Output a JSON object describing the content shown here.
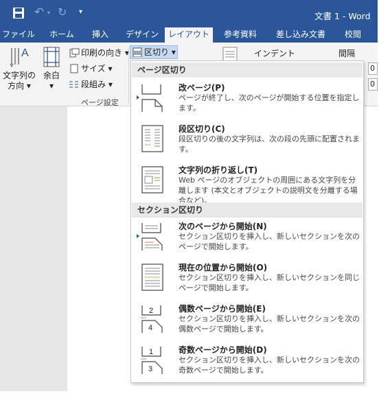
{
  "window": {
    "title": "文書 1 - Word"
  },
  "qat": {
    "undo_symbol": "↶",
    "redo_symbol": "↻",
    "more_symbol": "▾",
    "dropdown_symbol": "▾"
  },
  "tabs": [
    {
      "label": "ファイル"
    },
    {
      "label": "ホーム"
    },
    {
      "label": "挿入"
    },
    {
      "label": "デザイン"
    },
    {
      "label": "レイアウト"
    },
    {
      "label": "参考資料"
    },
    {
      "label": "差し込み文書"
    },
    {
      "label": "校閲"
    }
  ],
  "ribbon": {
    "text_direction": {
      "line1": "文字列の",
      "line2": "方向 ▾"
    },
    "margins": {
      "line1": "余白",
      "line2": "▾"
    },
    "orientation": "印刷の向き ▾",
    "size": "サイズ ▾",
    "columns": "段組み ▾",
    "breaks": "区切り ▾",
    "group_label": "ページ設定",
    "indent_label": "インデント",
    "spacing_label": "間隔",
    "spin1": "0",
    "spin2": "0"
  },
  "dropdown": {
    "page_breaks_header": "ページ区切り",
    "section_breaks_header": "セクション区切り",
    "items": [
      {
        "title": "改ページ(P)",
        "desc": "ページが終了し、次のページが開始する位置を指定します。"
      },
      {
        "title": "段区切り(C)",
        "desc": "段区切りの後の文字列は、次の段の先頭に配置されます。"
      },
      {
        "title": "文字列の折り返し(T)",
        "desc": "Web ページのオブジェクトの周囲にある文字列を分離します (本文とオブジェクトの説明文を分離する場合など)。"
      },
      {
        "title": "次のページから開始(N)",
        "desc": "セクション区切りを挿入し、新しいセクションを次のページで開始します。"
      },
      {
        "title": "現在の位置から開始(O)",
        "desc": "セクション区切りを挿入し、新しいセクションを同じページで開始します。"
      },
      {
        "title": "偶数ページから開始(E)",
        "desc": "セクション区切りを挿入し、新しいセクションを次の偶数ページで開始します。"
      },
      {
        "title": "奇数ページから開始(D)",
        "desc": "セクション区切りを挿入し、新しいセクションを次の奇数ページで開始します。"
      }
    ],
    "even_thumb_numbers": [
      "2",
      "4"
    ],
    "odd_thumb_numbers": [
      "1",
      "3"
    ]
  },
  "colors": {
    "brand": "#2b579a",
    "accent": "#e07b2a",
    "highlight": "#c5d9f1"
  }
}
